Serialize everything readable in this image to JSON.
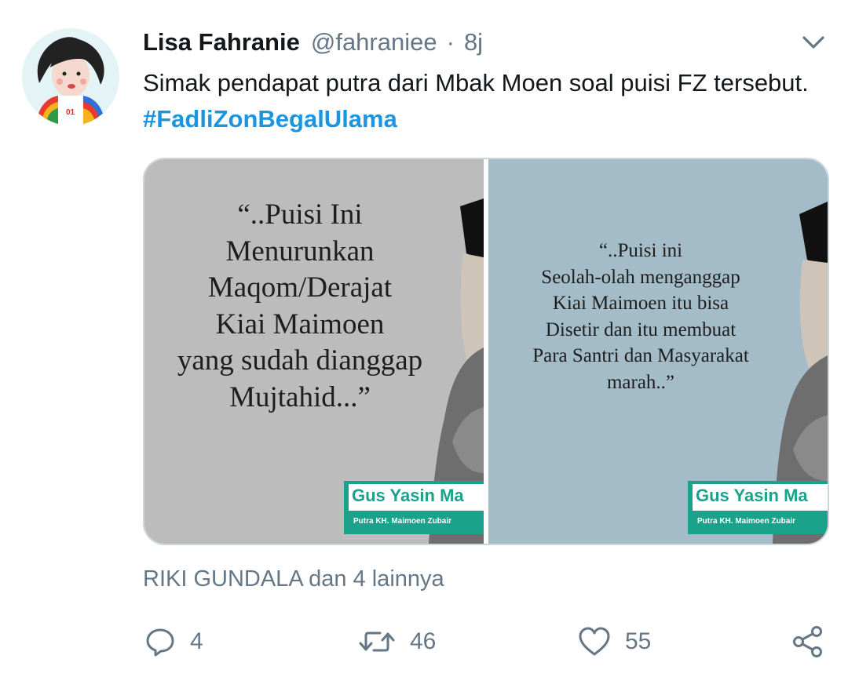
{
  "tweet": {
    "display_name": "Lisa Fahranie",
    "handle": "@fahraniee",
    "separator": "·",
    "time": "8j",
    "text_before_hashtag": "Simak pendapat putra dari Mbak Moen soal puisi FZ tersebut. ",
    "hashtag": "#FadliZonBegalUlama"
  },
  "media": [
    {
      "quote": "“..Puisi Ini\nMenurunkan\nMaqom/Derajat\nKiai Maimoen\nyang sudah dianggap\nMujtahid...”",
      "caption_name": "Gus Yasin Ma",
      "caption_sub": "Putra KH. Maimoen Zubair"
    },
    {
      "quote": "“..Puisi ini\nSeolah-olah menganggap\nKiai Maimoen itu bisa\nDisetir dan itu membuat\nPara Santri dan Masyarakat\nmarah..”",
      "caption_name": "Gus Yasin Ma",
      "caption_sub": "Putra KH. Maimoen Zubair"
    }
  ],
  "liked_by": "RIKI GUNDALA dan 4 lainnya",
  "actions": {
    "reply_count": "4",
    "retweet_count": "46",
    "like_count": "55"
  },
  "icons": {
    "caret": "chevron-down-icon",
    "reply": "speech-bubble-icon",
    "retweet": "retweet-arrows-icon",
    "like": "heart-outline-icon",
    "share": "share-nodes-icon"
  },
  "colors": {
    "hashtag": "#1b95e0",
    "secondary_text": "#657786",
    "caption_green": "#1aa28a"
  }
}
